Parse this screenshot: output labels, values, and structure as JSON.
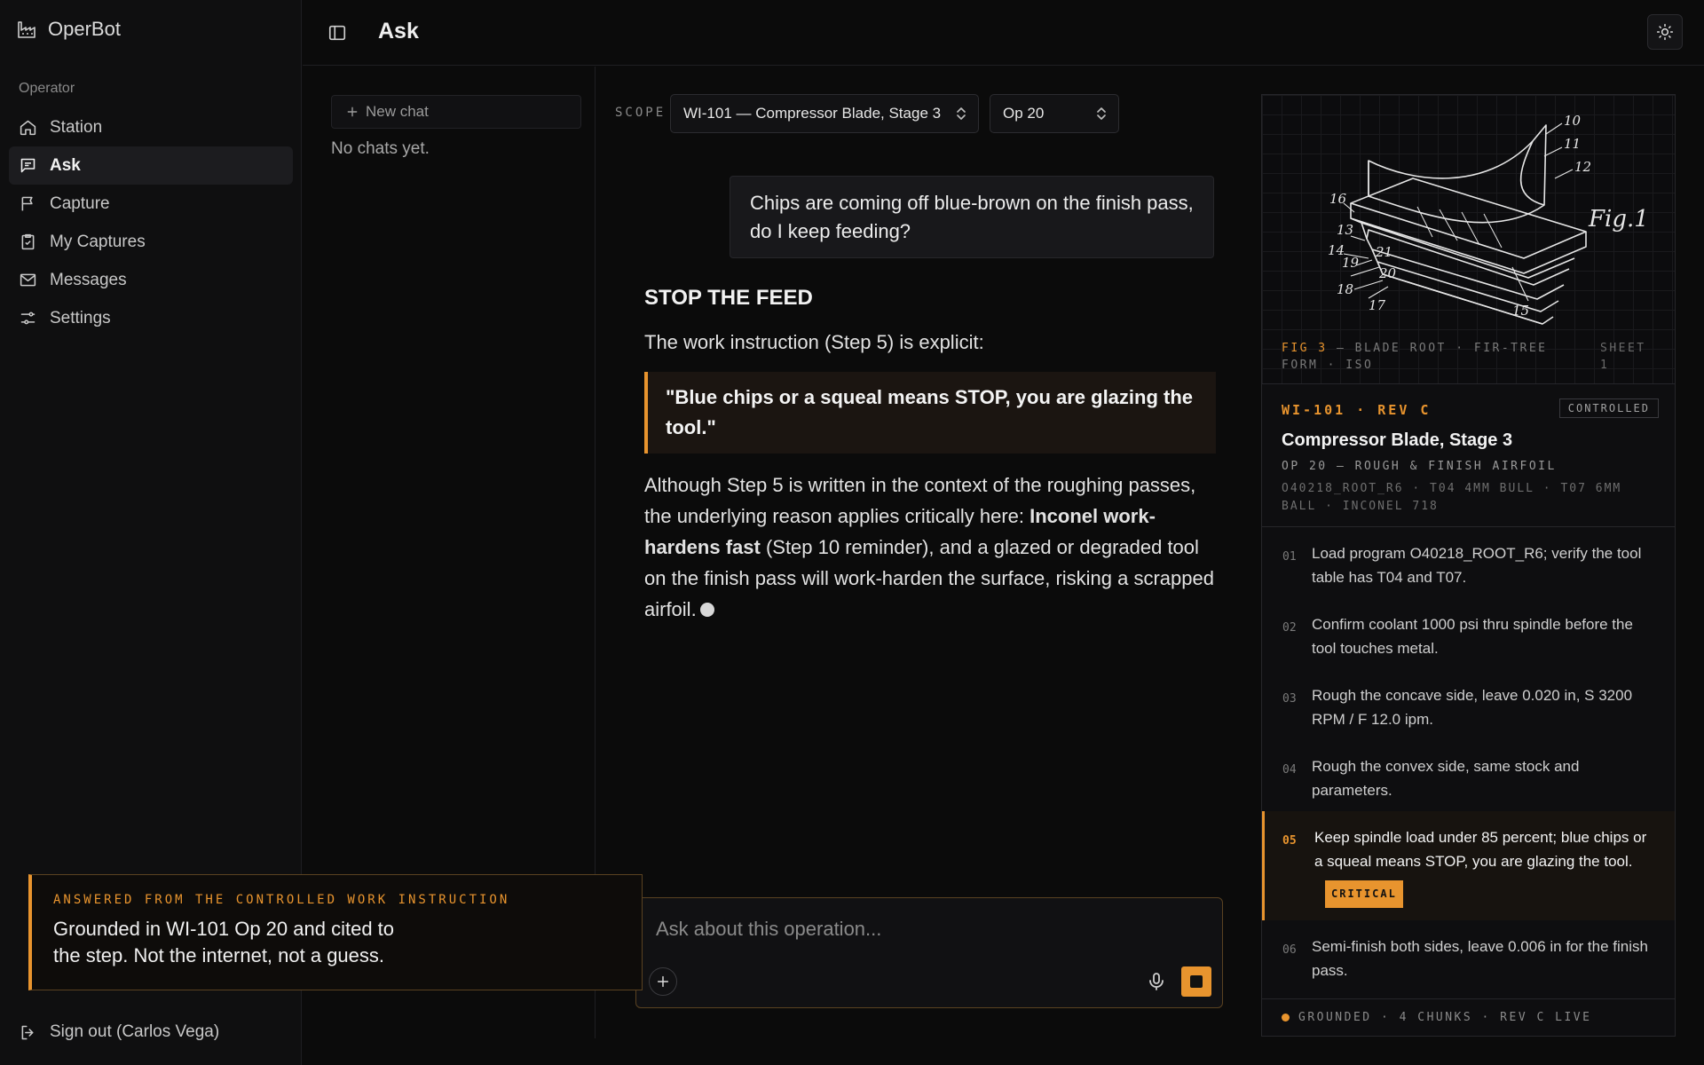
{
  "app": {
    "name": "OperBot"
  },
  "sidebar": {
    "section": "Operator",
    "items": [
      {
        "label": "Station",
        "icon": "home-icon"
      },
      {
        "label": "Ask",
        "icon": "chat-icon"
      },
      {
        "label": "Capture",
        "icon": "flag-icon"
      },
      {
        "label": "My Captures",
        "icon": "clipboard-icon"
      },
      {
        "label": "Messages",
        "icon": "mail-icon"
      },
      {
        "label": "Settings",
        "icon": "sliders-icon"
      }
    ],
    "active": "Ask",
    "signout": "Sign out (Carlos Vega)"
  },
  "header": {
    "title": "Ask"
  },
  "chats": {
    "new_label": "New chat",
    "empty": "No chats yet."
  },
  "scope": {
    "label": "SCOPE",
    "instruction": "WI-101 — Compressor Blade, Stage 3",
    "operation": "Op 20"
  },
  "conversation": {
    "user": "Chips are coming off blue-brown on the finish pass, do I keep feeding?",
    "answer": {
      "heading": "STOP THE FEED",
      "intro": "The work instruction (Step 5) is explicit:",
      "quote": "\"Blue chips or a squeal means STOP, you are glazing the tool.\"",
      "body_1": "Although Step 5 is written in the context of the roughing passes, the underlying reason applies critically here: ",
      "body_bold": "Inconel work-hardens fast",
      "body_2": " (Step 10 reminder), and a glazed or degraded tool on the finish pass will work-harden the surface, risking a scrapped airfoil."
    }
  },
  "composer": {
    "placeholder": "Ask about this operation..."
  },
  "callout": {
    "kicker": "ANSWERED FROM THE CONTROLLED WORK INSTRUCTION",
    "body": "Grounded in WI-101 Op 20 and cited to the step. Not the internet, not a guess."
  },
  "reference": {
    "figure_label": "Fig.1",
    "figure_numbers": [
      "10",
      "11",
      "12",
      "16",
      "13",
      "14",
      "19",
      "21",
      "20",
      "18",
      "17",
      "15"
    ],
    "fig_ref": "FIG 3",
    "fig_caption": " — BLADE ROOT · FIR-TREE FORM · ISO",
    "sheet": "SHEET 1",
    "doc_id": "WI-101 · REV C",
    "badge": "CONTROLLED",
    "title": "Compressor Blade, Stage 3",
    "op": "OP 20 — ROUGH & FINISH AIRFOIL",
    "meta": "O40218_ROOT_R6 · T04 4MM BULL · T07 6MM BALL · INCONEL 718",
    "steps": [
      {
        "num": "01",
        "text": "Load program O40218_ROOT_R6; verify the tool table has T04 and T07."
      },
      {
        "num": "02",
        "text": "Confirm coolant 1000 psi thru spindle before the tool touches metal."
      },
      {
        "num": "03",
        "text": "Rough the concave side, leave 0.020 in, S 3200 RPM / F 12.0 ipm."
      },
      {
        "num": "04",
        "text": "Rough the convex side, same stock and parameters."
      },
      {
        "num": "05",
        "text": "Keep spindle load under 85 percent; blue chips or a squeal means STOP, you are glazing the tool.",
        "tag": "CRITICAL"
      },
      {
        "num": "06",
        "text": "Semi-finish both sides, leave 0.006 in for the finish pass."
      }
    ],
    "footer": "GROUNDED · 4 CHUNKS · REV C LIVE"
  },
  "colors": {
    "accent": "#e8942e",
    "background": "#0b0b0b",
    "panel": "#0e0e10"
  }
}
